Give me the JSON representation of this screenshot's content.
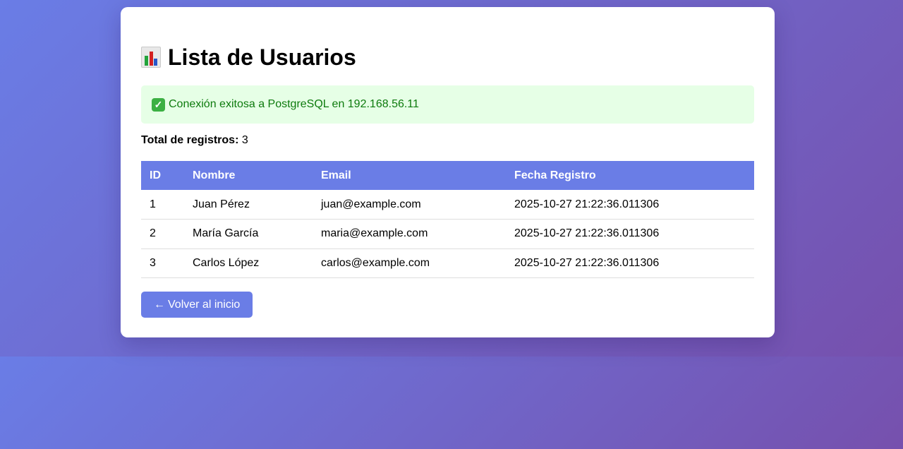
{
  "page": {
    "title": "Lista de Usuarios",
    "title_icon": "bar-chart-icon"
  },
  "alert": {
    "icon": "check-mark-icon",
    "message": "Conexión exitosa a PostgreSQL en 192.168.56.11",
    "bg_color": "#e6ffe6",
    "text_color": "#0d7a0d"
  },
  "summary": {
    "label": "Total de registros:",
    "value": "3"
  },
  "table": {
    "header_color": "#6a7de6",
    "columns": [
      "ID",
      "Nombre",
      "Email",
      "Fecha Registro"
    ],
    "rows": [
      [
        "1",
        "Juan Pérez",
        "juan@example.com",
        "2025-10-27 21:22:36.011306"
      ],
      [
        "2",
        "María García",
        "maria@example.com",
        "2025-10-27 21:22:36.011306"
      ],
      [
        "3",
        "Carlos López",
        "carlos@example.com",
        "2025-10-27 21:22:36.011306"
      ]
    ]
  },
  "back_button": {
    "arrow": "←",
    "label": "Volver al inicio"
  },
  "colors": {
    "accent": "#6a7de6",
    "gradient_end": "#7650ad"
  }
}
